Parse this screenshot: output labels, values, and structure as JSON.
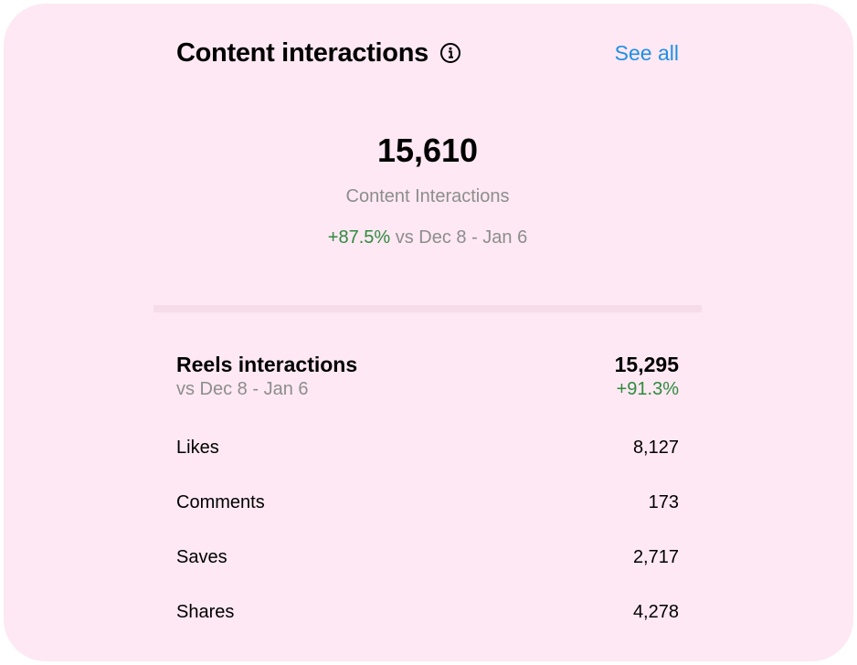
{
  "header": {
    "title": "Content interactions",
    "info_icon": "info-circle-icon",
    "see_all_label": "See all"
  },
  "summary": {
    "total": "15,610",
    "label": "Content Interactions",
    "change": "+87.5%",
    "comparison": "vs Dec 8 - Jan 6"
  },
  "reels": {
    "title": "Reels interactions",
    "comparison": "vs Dec 8 - Jan 6",
    "total": "15,295",
    "change": "+91.3%"
  },
  "metrics": [
    {
      "label": "Likes",
      "value": "8,127"
    },
    {
      "label": "Comments",
      "value": "173"
    },
    {
      "label": "Saves",
      "value": "2,717"
    },
    {
      "label": "Shares",
      "value": "4,278"
    }
  ],
  "colors": {
    "background": "#fde8f3",
    "accent_link": "#1e90e6",
    "positive": "#2e8b3e",
    "muted_text": "#8d8d8d"
  }
}
